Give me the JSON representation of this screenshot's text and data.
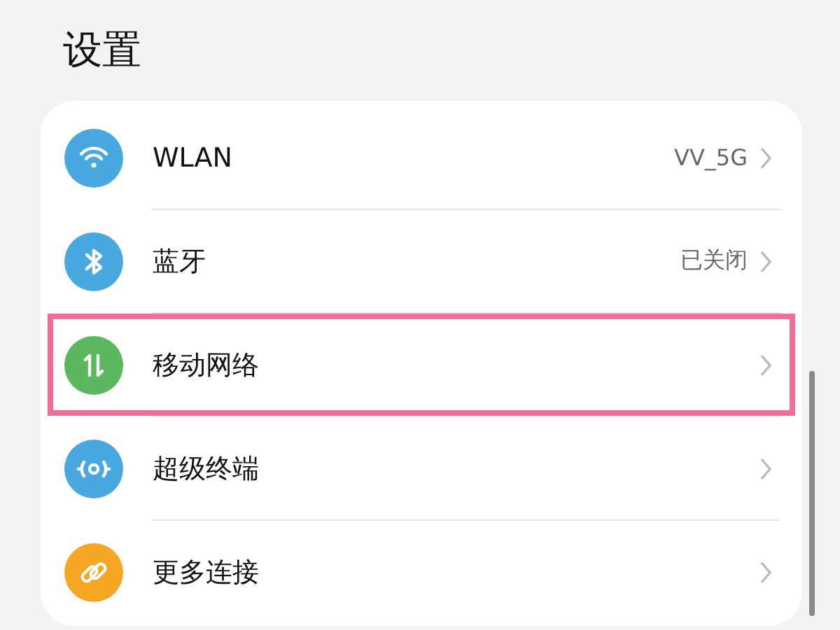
{
  "title": "设置",
  "items": [
    {
      "label": "WLAN",
      "value": "VV_5G",
      "color": "#4aa8e0",
      "highlighted": false
    },
    {
      "label": "蓝牙",
      "value": "已关闭",
      "color": "#4aa8e0",
      "highlighted": false
    },
    {
      "label": "移动网络",
      "color": "#5cb85c",
      "highlighted": true
    },
    {
      "label": "超级终端",
      "color": "#4aa8e0",
      "highlighted": false
    },
    {
      "label": "更多连接",
      "color": "#f5a623",
      "highlighted": false
    }
  ]
}
